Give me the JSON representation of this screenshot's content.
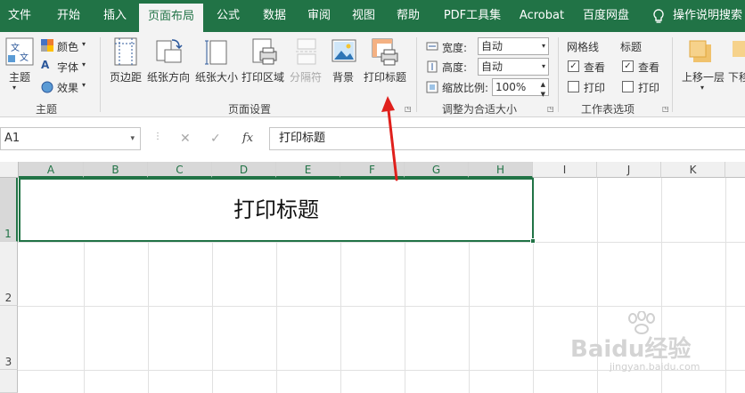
{
  "tabs": [
    {
      "label": "文件",
      "active": false
    },
    {
      "label": "开始",
      "active": false
    },
    {
      "label": "插入",
      "active": false
    },
    {
      "label": "页面布局",
      "active": true
    },
    {
      "label": "公式",
      "active": false
    },
    {
      "label": "数据",
      "active": false
    },
    {
      "label": "审阅",
      "active": false
    },
    {
      "label": "视图",
      "active": false
    },
    {
      "label": "帮助",
      "active": false
    },
    {
      "label": "PDF工具集",
      "active": false
    },
    {
      "label": "Acrobat",
      "active": false
    },
    {
      "label": "百度网盘",
      "active": false
    }
  ],
  "tell_me": "操作说明搜索",
  "ribbon": {
    "theme_group": {
      "label": "主题",
      "theme_button": "主题",
      "colors": "颜色",
      "fonts": "字体",
      "effects": "效果"
    },
    "page_setup_group": {
      "label": "页面设置",
      "margins": "页边距",
      "orientation": "纸张方向",
      "size": "纸张大小",
      "print_area": "打印区域",
      "breaks": "分隔符",
      "background": "背景",
      "print_titles": "打印标题"
    },
    "scale_group": {
      "label": "调整为合适大小",
      "width_label": "宽度:",
      "width_value": "自动",
      "height_label": "高度:",
      "height_value": "自动",
      "scale_label": "缩放比例:",
      "scale_value": "100%"
    },
    "sheet_options_group": {
      "label": "工作表选项",
      "gridlines": "网格线",
      "headings": "标题",
      "view": "查看",
      "print": "打印"
    },
    "arrange_group": {
      "bring_forward": "上移一层",
      "send_backward": "下移"
    }
  },
  "formula_bar": {
    "name_box": "A1",
    "cancel": "✕",
    "enter": "✓",
    "fx": "fx",
    "content": "打印标题"
  },
  "columns": [
    "A",
    "B",
    "C",
    "D",
    "E",
    "F",
    "G",
    "H",
    "I",
    "J",
    "K"
  ],
  "rows": [
    "1",
    "2",
    "3"
  ],
  "cell_a1": "打印标题",
  "watermark": {
    "brand": "Baidu经验",
    "url": "jingyan.baidu.com"
  },
  "colors": {
    "excel_green": "#217346",
    "annotation_red": "#e0201c"
  }
}
